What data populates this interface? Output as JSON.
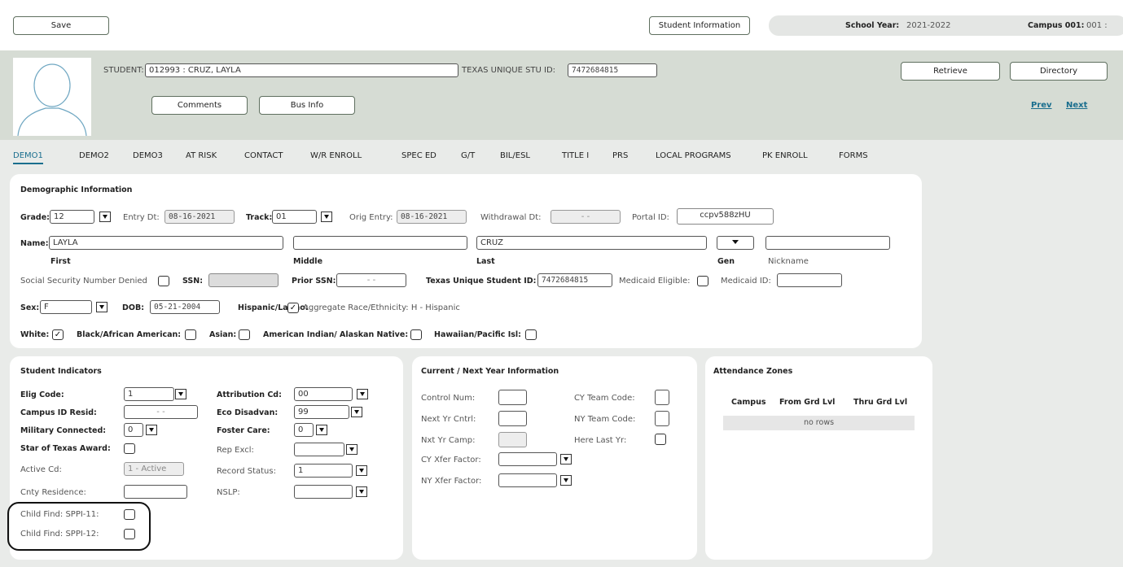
{
  "topbar": {
    "save": "Save",
    "student_info": "Student Information",
    "school_year_label": "School Year:",
    "school_year_value": "2021-2022",
    "campus_label": "Campus 001:",
    "campus_value": "001 :"
  },
  "student_header": {
    "student_label": "STUDENT:",
    "student_value": "012993 : CRUZ, LAYLA",
    "tsid_label": "TEXAS UNIQUE STU ID:",
    "tsid_value": "7472684815",
    "comments": "Comments",
    "bus_info": "Bus Info",
    "retrieve": "Retrieve",
    "directory": "Directory",
    "prev": "Prev",
    "next": "Next"
  },
  "tabs": [
    "DEMO1",
    "DEMO2",
    "DEMO3",
    "AT RISK",
    "CONTACT",
    "W/R ENROLL",
    "SPEC ED",
    "G/T",
    "BIL/ESL",
    "TITLE I",
    "PRS",
    "LOCAL PROGRAMS",
    "PK ENROLL",
    "FORMS"
  ],
  "demographic": {
    "title": "Demographic Information",
    "grade_label": "Grade:",
    "grade_value": "12",
    "entry_label": "Entry Dt:",
    "entry_value": "08-16-2021",
    "track_label": "Track:",
    "track_value": "01",
    "orig_label": "Orig Entry:",
    "orig_value": "08-16-2021",
    "withdrawal_label": "Withdrawal Dt:",
    "withdrawal_value": "-  -",
    "portal_label": "Portal ID:",
    "portal_value": "ccpv588zHU",
    "name_label": "Name:",
    "first_value": "LAYLA",
    "middle_value": "",
    "last_value": "CRUZ",
    "nickname_value": "",
    "first_caption": "First",
    "middle_caption": "Middle",
    "last_caption": "Last",
    "gen_caption": "Gen",
    "nickname_caption": "Nickname",
    "ssn_denied_label": "Social Security Number Denied",
    "ssn_label": "SSN:",
    "prior_ssn_label": "Prior SSN:",
    "prior_ssn_value": "-  -",
    "tx_student_id_label": "Texas Unique Student ID:",
    "tx_student_id_value": "7472684815",
    "medicaid_eligible_label": "Medicaid Eligible:",
    "medicaid_id_label": "Medicaid ID:",
    "medicaid_id_value": "",
    "sex_label": "Sex:",
    "sex_value": "F",
    "dob_label": "DOB:",
    "dob_value": "05-21-2004",
    "hispanic_label": "Hispanic/Latino:",
    "aggregate_label": "Aggregate Race/Ethnicity: H - Hispanic",
    "white_label": "White:",
    "black_label": "Black/African American:",
    "asian_label": "Asian:",
    "amind_label": "American Indian/ Alaskan Native:",
    "hawaiian_label": "Hawaiian/Pacific Isl:",
    "check_mark": "✓"
  },
  "indicators": {
    "title": "Student Indicators",
    "elig_label": "Elig Code:",
    "elig_value": "1",
    "campus_resid_label": "Campus ID Resid:",
    "campus_resid_value": "-  -",
    "military_label": "Military Connected:",
    "military_value": "0",
    "star_label": "Star of Texas Award:",
    "active_label": "Active Cd:",
    "active_value": "1 - Active",
    "cnty_label": "Cnty Residence:",
    "cnty_value": "",
    "child_find_11": "Child Find: SPPI-11:",
    "child_find_12": "Child Find: SPPI-12:",
    "attribution_label": "Attribution Cd:",
    "attribution_value": "00",
    "eco_label": "Eco Disadvan:",
    "eco_value": "99",
    "foster_label": "Foster Care:",
    "foster_value": "0",
    "rep_excl_label": "Rep Excl:",
    "rep_excl_value": "",
    "record_status_label": "Record Status:",
    "record_status_value": "1",
    "nslp_label": "NSLP:",
    "nslp_value": ""
  },
  "current_next": {
    "title": "Current / Next Year Information",
    "control_label": "Control Num:",
    "next_cntrl_label": "Next Yr Cntrl:",
    "nxt_camp_label": "Nxt Yr Camp:",
    "cy_xfer_label": "CY Xfer Factor:",
    "ny_xfer_label": "NY Xfer Factor:",
    "cy_team_label": "CY Team Code:",
    "ny_team_label": "NY Team Code:",
    "here_last_label": "Here Last Yr:"
  },
  "attendance": {
    "title": "Attendance Zones",
    "columns": [
      "Campus",
      "From Grd Lvl",
      "Thru Grd Lvl"
    ],
    "empty": "no rows"
  }
}
